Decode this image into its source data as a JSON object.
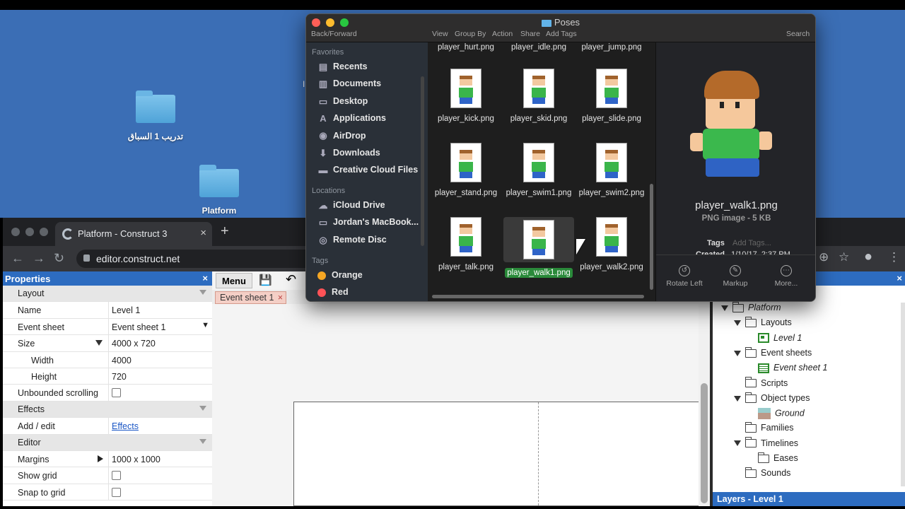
{
  "desktop": {
    "icons": [
      {
        "label": "تدريب 1 السباق"
      },
      {
        "label": "Platform"
      }
    ],
    "partial_char": "I"
  },
  "browser": {
    "tab_title": "Platform - Construct 3",
    "tab_close": "×",
    "new_tab": "+",
    "url": "editor.construct.net",
    "nav": {
      "back": "←",
      "forward": "→",
      "reload": "↻"
    },
    "right_icons": {
      "extension": "⊕",
      "bookmark": "☆",
      "profile": "●",
      "menu": "⋮"
    }
  },
  "properties": {
    "header": "Properties",
    "close": "×",
    "rows": [
      {
        "type": "cat",
        "name": "Layout"
      },
      {
        "type": "row",
        "name": "Name",
        "value": "Level 1"
      },
      {
        "type": "select",
        "name": "Event sheet",
        "value": "Event sheet 1"
      },
      {
        "type": "expand",
        "name": "Size",
        "value": "4000 x 720"
      },
      {
        "type": "sub",
        "name": "Width",
        "value": "4000"
      },
      {
        "type": "sub",
        "name": "Height",
        "value": "720"
      },
      {
        "type": "check",
        "name": "Unbounded scrolling",
        "checked": false
      },
      {
        "type": "cat",
        "name": "Effects"
      },
      {
        "type": "link",
        "name": "Add / edit",
        "value": "Effects"
      },
      {
        "type": "cat",
        "name": "Editor"
      },
      {
        "type": "collapsed",
        "name": "Margins",
        "value": "1000 x 1000"
      },
      {
        "type": "check",
        "name": "Show grid",
        "checked": false
      },
      {
        "type": "check",
        "name": "Snap to grid",
        "checked": false
      }
    ]
  },
  "editor": {
    "menu_label": "Menu",
    "save_icon": "💾",
    "undo_icon": "↶",
    "tab_label": "Event sheet 1",
    "tab_close": "×"
  },
  "project": {
    "close": "×",
    "tree": [
      {
        "label": "Platform",
        "level": 0,
        "kind": "folder",
        "expanded": true,
        "italic": true
      },
      {
        "label": "Layouts",
        "level": 1,
        "kind": "folder",
        "expanded": true
      },
      {
        "label": "Level 1",
        "level": 2,
        "kind": "layout",
        "italic": true
      },
      {
        "label": "Event sheets",
        "level": 1,
        "kind": "folder",
        "expanded": true
      },
      {
        "label": "Event sheet 1",
        "level": 2,
        "kind": "eventsheet",
        "italic": true
      },
      {
        "label": "Scripts",
        "level": 1,
        "kind": "folder"
      },
      {
        "label": "Object types",
        "level": 1,
        "kind": "folder",
        "expanded": true
      },
      {
        "label": "Ground",
        "level": 2,
        "kind": "sprite",
        "italic": true
      },
      {
        "label": "Families",
        "level": 1,
        "kind": "folder"
      },
      {
        "label": "Timelines",
        "level": 1,
        "kind": "folder",
        "expanded": true
      },
      {
        "label": "Eases",
        "level": 2,
        "kind": "folder"
      },
      {
        "label": "Sounds",
        "level": 1,
        "kind": "folder"
      }
    ],
    "layers_header": "Layers - Level 1"
  },
  "finder": {
    "title": "Poses",
    "toolbar": {
      "back_forward": "Back/Forward",
      "view": "View",
      "group_by": "Group By",
      "action": "Action",
      "share": "Share",
      "add_tags": "Add Tags",
      "search": "Search"
    },
    "sidebar": {
      "favorites_header": "Favorites",
      "favorites": [
        {
          "label": "Recents",
          "icon": "▤"
        },
        {
          "label": "Documents",
          "icon": "▥"
        },
        {
          "label": "Desktop",
          "icon": "▭"
        },
        {
          "label": "Applications",
          "icon": "A"
        },
        {
          "label": "AirDrop",
          "icon": "◉"
        },
        {
          "label": "Downloads",
          "icon": "⬇"
        },
        {
          "label": "Creative Cloud Files",
          "icon": "▬"
        }
      ],
      "locations_header": "Locations",
      "locations": [
        {
          "label": "iCloud Drive",
          "icon": "☁"
        },
        {
          "label": "Jordan's MacBook...",
          "icon": "▭"
        },
        {
          "label": "Remote Disc",
          "icon": "◎"
        }
      ],
      "tags_header": "Tags",
      "tags": [
        {
          "label": "Orange",
          "color": "#f5a623"
        },
        {
          "label": "Red",
          "color": "#ff5257"
        }
      ]
    },
    "files_top": [
      "player_hurt.png",
      "player_idle.png",
      "player_jump.png"
    ],
    "files": [
      {
        "name": "player_kick.png"
      },
      {
        "name": "player_skid.png"
      },
      {
        "name": "player_slide.png"
      },
      {
        "name": "player_stand.png"
      },
      {
        "name": "player_swim1.png"
      },
      {
        "name": "player_swim2.png"
      },
      {
        "name": "player_talk.png"
      },
      {
        "name": "player_walk1.png",
        "selected": true
      },
      {
        "name": "player_walk2.png"
      }
    ],
    "preview": {
      "name": "player_walk1.png",
      "kind": "PNG image - 5 KB",
      "tags_label": "Tags",
      "tags_placeholder": "Add Tags...",
      "created_label": "Created",
      "created_value": "1/10/17, 2:37 PM",
      "actions": [
        {
          "label": "Rotate Left",
          "icon": "↺"
        },
        {
          "label": "Markup",
          "icon": "✎"
        },
        {
          "label": "More...",
          "icon": "⋯"
        }
      ]
    }
  },
  "colors": {
    "desktop": "#3b6eb5",
    "panel_header": "#2d6cc0",
    "selection_green": "#2a8a3a",
    "finder_sidebar": "#2a3038"
  }
}
